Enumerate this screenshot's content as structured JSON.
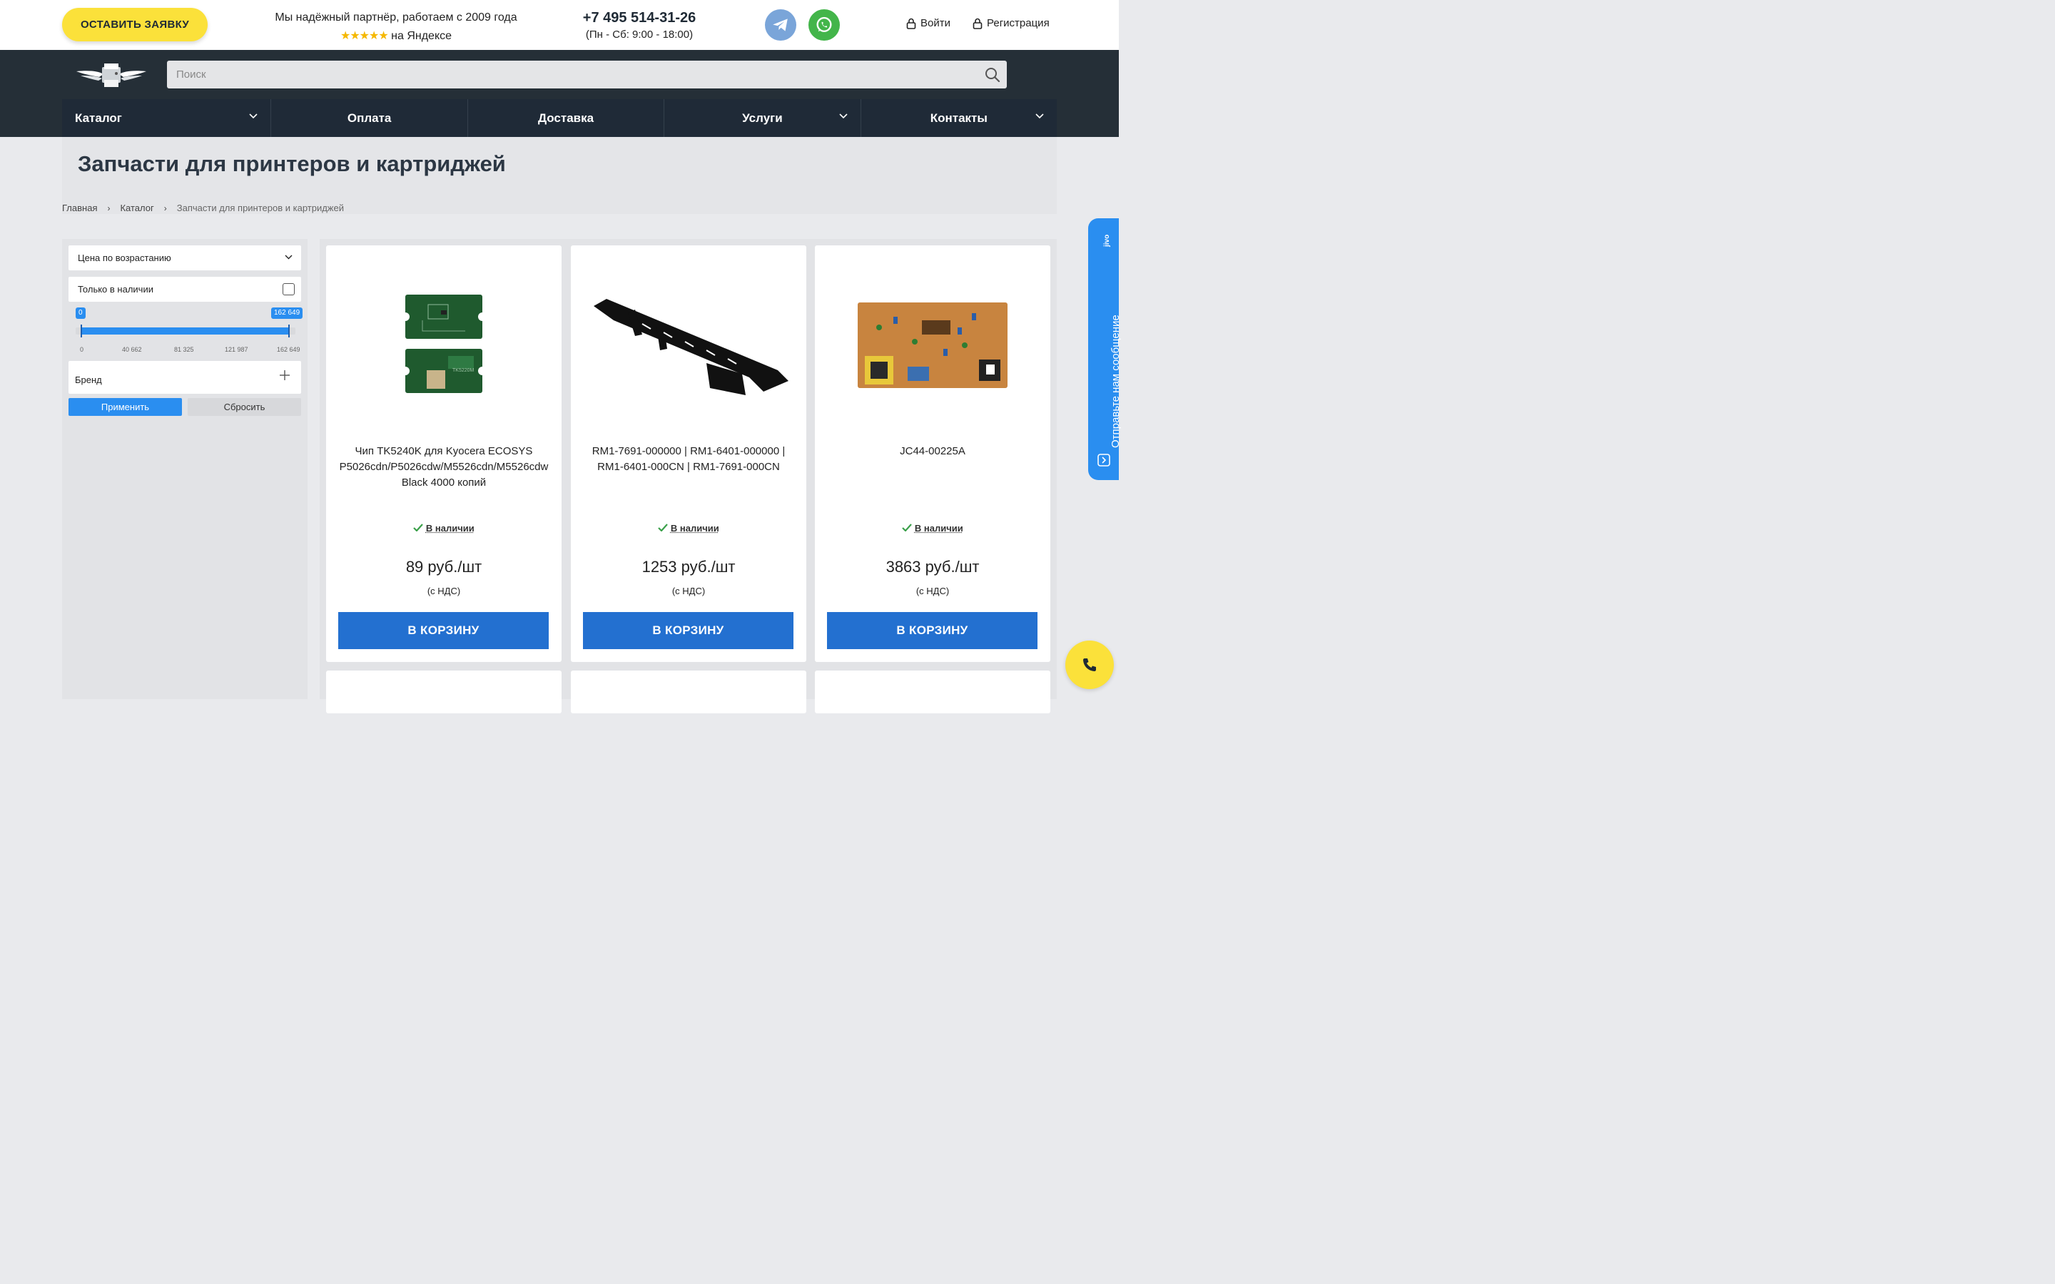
{
  "header": {
    "request_button": "ОСТАВИТЬ ЗАЯВКУ",
    "partner_line1": "Мы надёжный партнёр, работаем с 2009 года",
    "partner_stars": "★★★★★",
    "partner_line2": "на Яндексе",
    "phone": "+7 495 514-31-26",
    "hours": "(Пн - Сб: 9:00 - 18:00)",
    "login": "Войти",
    "register": "Регистрация"
  },
  "search": {
    "placeholder": "Поиск"
  },
  "nav": {
    "items": [
      {
        "label": "Каталог"
      },
      {
        "label": "Оплата"
      },
      {
        "label": "Доставка"
      },
      {
        "label": "Услуги"
      },
      {
        "label": "Контакты"
      }
    ]
  },
  "page": {
    "title": "Запчасти для принтеров и картриджей",
    "breadcrumb": [
      "Главная",
      "Каталог",
      "Запчасти для принтеров и картриджей"
    ]
  },
  "filters": {
    "sort_label": "Цена по возрастанию",
    "in_stock_label": "Только в наличии",
    "in_stock_checked": false,
    "price_min": "0",
    "price_max": "162 649",
    "ticks": [
      "0",
      "40 662",
      "81 325",
      "121 987",
      "162 649"
    ],
    "brand_label": "Бренд",
    "apply_label": "Применить",
    "reset_label": "Сбросить"
  },
  "products": [
    {
      "name": "Чип TK5240K для Kyocera ECOSYS P5026cdn/P5026cdw/M5526cdn/M5526cdw Black 4000 копий",
      "availability": "В наличии",
      "price": "89 руб./шт",
      "vat": "(с НДС)",
      "cart_label": "В КОРЗИНУ",
      "chip_marking": "TK5220M"
    },
    {
      "name": "RM1-7691-000000 | RM1-6401-000000 | RM1-6401-000CN | RM1-7691-000CN",
      "availability": "В наличии",
      "price": "1253 руб./шт",
      "vat": "(с НДС)",
      "cart_label": "В КОРЗИНУ"
    },
    {
      "name": "JC44-00225A",
      "availability": "В наличии",
      "price": "3863 руб./шт",
      "vat": "(с НДС)",
      "cart_label": "В КОРЗИНУ"
    }
  ],
  "jivo": {
    "label": "jivo",
    "text": "Отправьте нам сообщение"
  },
  "colors": {
    "accent_yellow": "#fbe13a",
    "dark_band": "#252f37",
    "nav_bg": "#1f2a37",
    "cart_blue": "#2370d0",
    "filter_blue": "#2a8ef0",
    "stock_green": "#3aa04a"
  }
}
